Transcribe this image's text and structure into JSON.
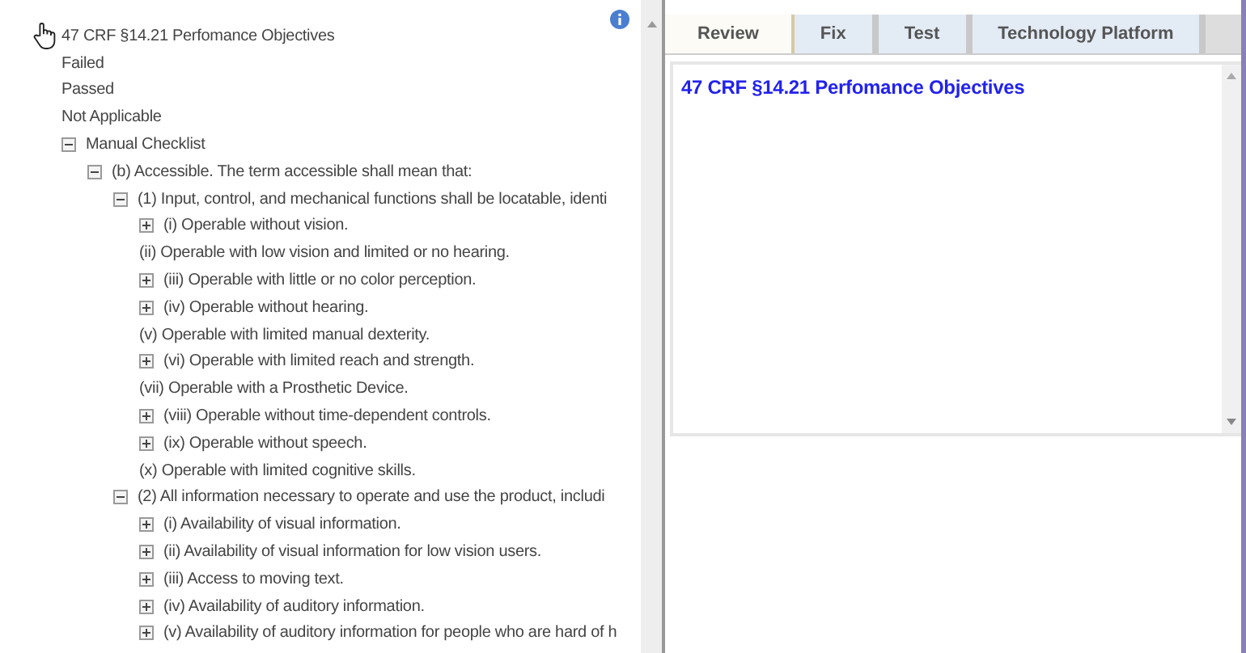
{
  "tree": {
    "label": "47 CRF §14.21 Perfomance Objectives",
    "children": [
      {
        "label": "Failed"
      },
      {
        "label": "Passed"
      },
      {
        "label": "Not Applicable"
      },
      {
        "label": "Manual Checklist",
        "expanded": true,
        "children": [
          {
            "label": "(b) Accessible. The term accessible shall mean that:",
            "expanded": true,
            "children": [
              {
                "label": "(1) Input, control, and mechanical functions shall be locatable, identi",
                "expanded": true,
                "children": [
                  {
                    "label": "(i) Operable without vision.",
                    "expanded": false
                  },
                  {
                    "label": "(ii) Operable with low vision and limited or no hearing."
                  },
                  {
                    "label": "(iii) Operable with little or no color perception.",
                    "expanded": false
                  },
                  {
                    "label": "(iv) Operable without hearing.",
                    "expanded": false
                  },
                  {
                    "label": "(v) Operable with limited manual dexterity."
                  },
                  {
                    "label": "(vi) Operable with limited reach and strength.",
                    "expanded": false
                  },
                  {
                    "label": "(vii) Operable with a Prosthetic Device."
                  },
                  {
                    "label": "(viii) Operable without time-dependent controls.",
                    "expanded": false
                  },
                  {
                    "label": "(ix) Operable without speech.",
                    "expanded": false
                  },
                  {
                    "label": "(x) Operable with limited cognitive skills."
                  }
                ]
              },
              {
                "label": "(2) All information necessary to operate and use the product, includi",
                "expanded": true,
                "children": [
                  {
                    "label": "(i) Availability of visual information.",
                    "expanded": false
                  },
                  {
                    "label": "(ii) Availability of visual information for low vision users.",
                    "expanded": false
                  },
                  {
                    "label": "(iii) Access to moving text.",
                    "expanded": false
                  },
                  {
                    "label": "(iv) Availability of auditory information.",
                    "expanded": false
                  },
                  {
                    "label": "(v) Availability of auditory information for people who are hard of h",
                    "expanded": false
                  }
                ]
              }
            ]
          }
        ]
      }
    ]
  },
  "tabs": [
    {
      "label": "Review",
      "selected": true
    },
    {
      "label": "Fix",
      "selected": false
    },
    {
      "label": "Test",
      "selected": false
    },
    {
      "label": "Technology Platform",
      "selected": false
    }
  ],
  "review": {
    "heading": "47 CRF §14.21 Perfomance Objectives"
  }
}
